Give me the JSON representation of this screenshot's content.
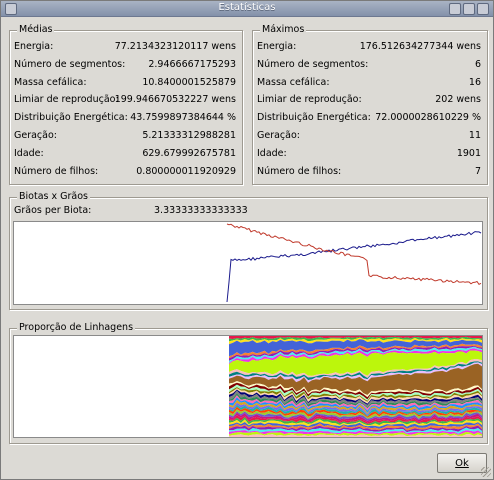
{
  "window": {
    "title": "Estatísticas"
  },
  "medias": {
    "title": "Médias",
    "rows": [
      {
        "label": "Energia:",
        "value": "77.2134323120117 wens"
      },
      {
        "label": "Número de segmentos:",
        "value": "2.9466667175293"
      },
      {
        "label": "Massa cefálica:",
        "value": "10.8400001525879"
      },
      {
        "label": "Limiar de reprodução:",
        "value": "199.946670532227 wens"
      },
      {
        "label": "Distribuição Energética:",
        "value": "43.7599897384644 %"
      },
      {
        "label": "Geração:",
        "value": "5.21333312988281"
      },
      {
        "label": "Idade:",
        "value": "629.679992675781"
      },
      {
        "label": "Número de filhos:",
        "value": "0.800000011920929"
      }
    ]
  },
  "maximos": {
    "title": "Máximos",
    "rows": [
      {
        "label": "Energia:",
        "value": "176.512634277344 wens"
      },
      {
        "label": "Número de segmentos:",
        "value": "6"
      },
      {
        "label": "Massa cefálica:",
        "value": "16"
      },
      {
        "label": "Limiar de reprodução:",
        "value": "202 wens"
      },
      {
        "label": "Distribuição Energética:",
        "value": "72.0000028610229 %"
      },
      {
        "label": "Geração:",
        "value": "11"
      },
      {
        "label": "Idade:",
        "value": "1901"
      },
      {
        "label": "Número de filhos:",
        "value": "7"
      }
    ]
  },
  "biotas": {
    "title": "Biotas x Grãos",
    "ratio_label": "Grãos per Biota:",
    "ratio_value": "3.33333333333333",
    "colors": {
      "biotas": "#1a1a8c",
      "graos": "#c0392b"
    }
  },
  "linhagens": {
    "title": "Proporção de Linhagens"
  },
  "buttons": {
    "ok": "Ok"
  }
}
